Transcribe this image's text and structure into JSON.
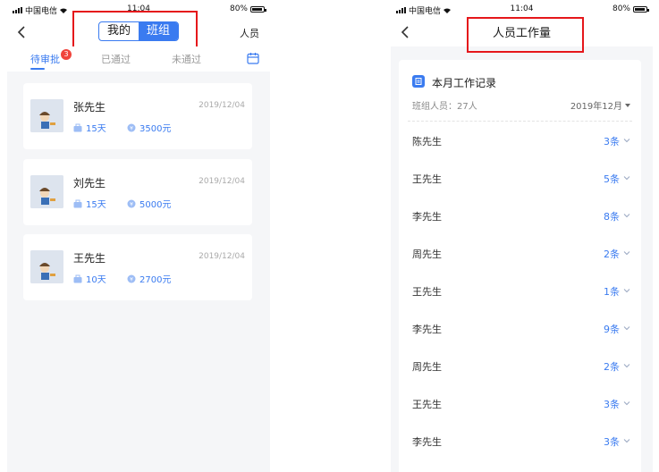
{
  "left": {
    "status": {
      "carrier": "中国电信",
      "time": "11:04",
      "battery": "80%",
      "battery_level": 0.8
    },
    "segmented": {
      "options": [
        "我的",
        "班组"
      ],
      "selected": "班组"
    },
    "nav_right": "人员",
    "tabs": [
      {
        "label": "待审批",
        "badge": "3",
        "active": true
      },
      {
        "label": "已通过"
      },
      {
        "label": "未通过"
      }
    ],
    "cards": [
      {
        "name": "张先生",
        "date": "2019/12/04",
        "days": "15天",
        "amount": "3500元"
      },
      {
        "name": "刘先生",
        "date": "2019/12/04",
        "days": "15天",
        "amount": "5000元"
      },
      {
        "name": "王先生",
        "date": "2019/12/04",
        "days": "10天",
        "amount": "2700元"
      }
    ]
  },
  "right": {
    "status": {
      "carrier": "中国电信",
      "time": "11:04",
      "battery": "80%",
      "battery_level": 0.8
    },
    "title": "人员工作量",
    "panel": {
      "title": "本月工作记录",
      "members": "班组人员：27人",
      "month": "2019年12月"
    },
    "rows": [
      {
        "name": "陈先生",
        "count": "3条"
      },
      {
        "name": "王先生",
        "count": "5条"
      },
      {
        "name": "李先生",
        "count": "8条"
      },
      {
        "name": "周先生",
        "count": "2条"
      },
      {
        "name": "王先生",
        "count": "1条"
      },
      {
        "name": "李先生",
        "count": "9条"
      },
      {
        "name": "周先生",
        "count": "2条"
      },
      {
        "name": "王先生",
        "count": "3条"
      },
      {
        "name": "李先生",
        "count": "3条"
      }
    ]
  },
  "colors": {
    "accent": "#3a7bf0",
    "highlight_box": "#e5171b",
    "badge": "#f0443c"
  }
}
